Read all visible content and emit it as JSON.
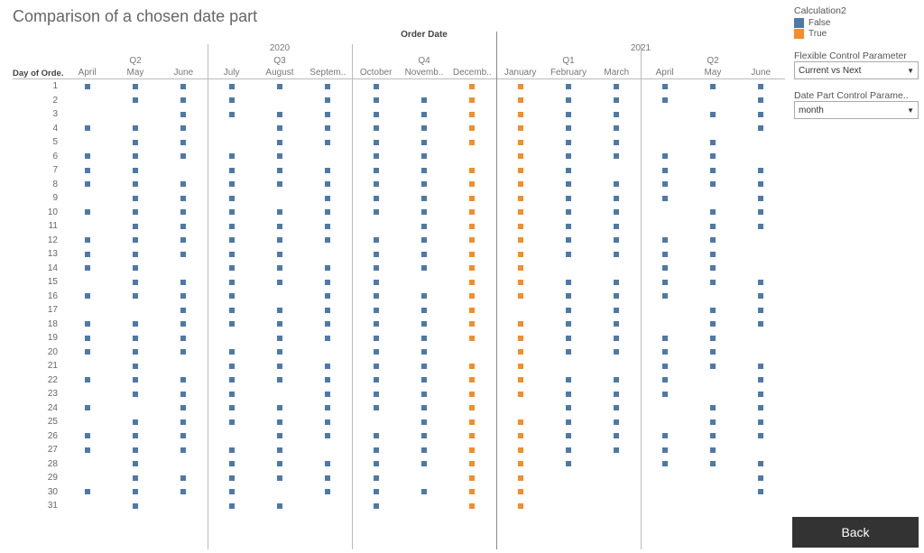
{
  "title": "Comparison of a chosen date part",
  "order_date_label": "Order Date",
  "row_header_label": "Day of Orde..",
  "legend": {
    "title": "Calculation2",
    "false_label": "False",
    "true_label": "True",
    "false_color": "#4e79a7",
    "true_color": "#f28e2b"
  },
  "param1": {
    "label": "Flexible Control Parameter",
    "value": "Current vs Next"
  },
  "param2": {
    "label": "Date Part Control Parame..",
    "value": "month"
  },
  "back_label": "Back",
  "chart_data": {
    "type": "heatmap",
    "title": "Comparison of a chosen date part",
    "xlabel": "Order Date",
    "ylabel": "Day of Order Date",
    "years": [
      {
        "label": "2020",
        "span": 9
      },
      {
        "label": "2021",
        "span": 6
      }
    ],
    "quarters": [
      {
        "label": "Q2",
        "span": 3
      },
      {
        "label": "Q3",
        "span": 3
      },
      {
        "label": "Q4",
        "span": 3
      },
      {
        "label": "Q1",
        "span": 3
      },
      {
        "label": "Q2",
        "span": 3
      }
    ],
    "months": [
      "April",
      "May",
      "June",
      "July",
      "August",
      "Septem..",
      "October",
      "Novemb..",
      "Decemb..",
      "January",
      "February",
      "March",
      "April",
      "May",
      "June"
    ],
    "month_days": [
      30,
      31,
      30,
      31,
      31,
      30,
      31,
      30,
      31,
      31,
      28,
      31,
      30,
      31,
      30
    ],
    "highlighted_months": [
      "Decemb..",
      "January"
    ],
    "row_labels": [
      "1",
      "2",
      "3",
      "4",
      "5",
      "6",
      "7",
      "8",
      "9",
      "10",
      "11",
      "12",
      "13",
      "14",
      "15",
      "16",
      "17",
      "18",
      "19",
      "20",
      "21",
      "22",
      "23",
      "24",
      "25",
      "26",
      "27",
      "28",
      "29",
      "30",
      "31"
    ],
    "missing": {
      "April_2020_0": [
        2,
        3,
        5,
        9,
        11,
        15,
        17,
        21,
        23,
        25,
        28,
        29
      ],
      "May_2020_1": [
        3,
        17,
        24
      ],
      "June_2020_2": [
        7,
        14,
        21,
        28
      ],
      "July_2020_3": [
        4,
        5,
        19,
        26
      ],
      "August_2020_4": [
        2,
        9,
        16,
        23,
        30
      ],
      "Septem_2020_5": [
        6,
        13,
        20,
        27
      ],
      "October_2020_6": [
        11,
        25
      ],
      "Novemb_2020_7": [
        1,
        15,
        29
      ],
      "Decemb_2020_8": [
        6,
        20
      ],
      "January_2021_9": [
        17,
        24
      ],
      "February_2021_10": [
        14,
        21,
        29,
        30,
        31
      ],
      "March_2021_11": [
        7,
        14,
        21,
        28,
        29,
        30,
        31
      ],
      "April_2021_12": [
        3,
        4,
        5,
        10,
        11,
        17,
        18,
        24,
        25,
        29,
        30
      ],
      "May_2021_13": [
        2,
        4,
        9,
        16,
        22,
        23,
        29,
        30,
        31
      ],
      "June_2021_14": [
        5,
        6,
        12,
        13,
        14,
        19,
        20,
        27
      ]
    }
  }
}
